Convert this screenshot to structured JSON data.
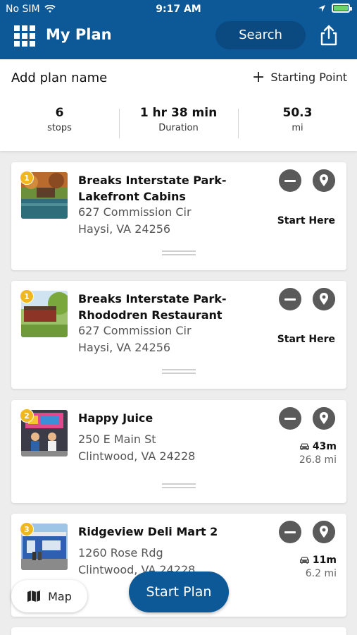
{
  "status_bar": {
    "carrier": "No SIM",
    "time": "9:17 AM"
  },
  "nav": {
    "title": "My Plan",
    "search_label": "Search"
  },
  "plan": {
    "name_placeholder": "Add plan name",
    "starting_point_label": "Starting Point",
    "stats": [
      {
        "value": "6",
        "label": "stops"
      },
      {
        "value": "1 hr 38 min",
        "label": "Duration"
      },
      {
        "value": "50.3",
        "label": "mi"
      }
    ]
  },
  "stops": [
    {
      "number": "1",
      "title_line1": "Breaks Interstate Park-",
      "title_line2": "Lakefront Cabins",
      "address_line1": "627 Commission Cir",
      "address_line2": "Haysi, VA 24256",
      "action": "Start Here"
    },
    {
      "number": "1",
      "title_line1": "Breaks Interstate Park-",
      "title_line2": "Rhododren Restaurant",
      "address_line1": "627 Commission Cir",
      "address_line2": "Haysi, VA 24256",
      "action": "Start Here"
    },
    {
      "number": "2",
      "title_line1": "Happy Juice",
      "address_line1": "250 E Main St",
      "address_line2": "Clintwood, VA 24228",
      "drive_time": "43m",
      "drive_distance": "26.8 mi"
    },
    {
      "number": "3",
      "title_line1": "Ridgeview Deli Mart 2",
      "address_line1": "1260 Rose Rdg",
      "address_line2": "Clintwood, VA 24228",
      "drive_time": "11m",
      "drive_distance": "6.2 mi"
    }
  ],
  "buttons": {
    "map_label": "Map",
    "start_plan_label": "Start Plan"
  },
  "colors": {
    "primary": "#0d5897",
    "badge": "#f0b721",
    "icon_circle": "#5a5a5a"
  }
}
